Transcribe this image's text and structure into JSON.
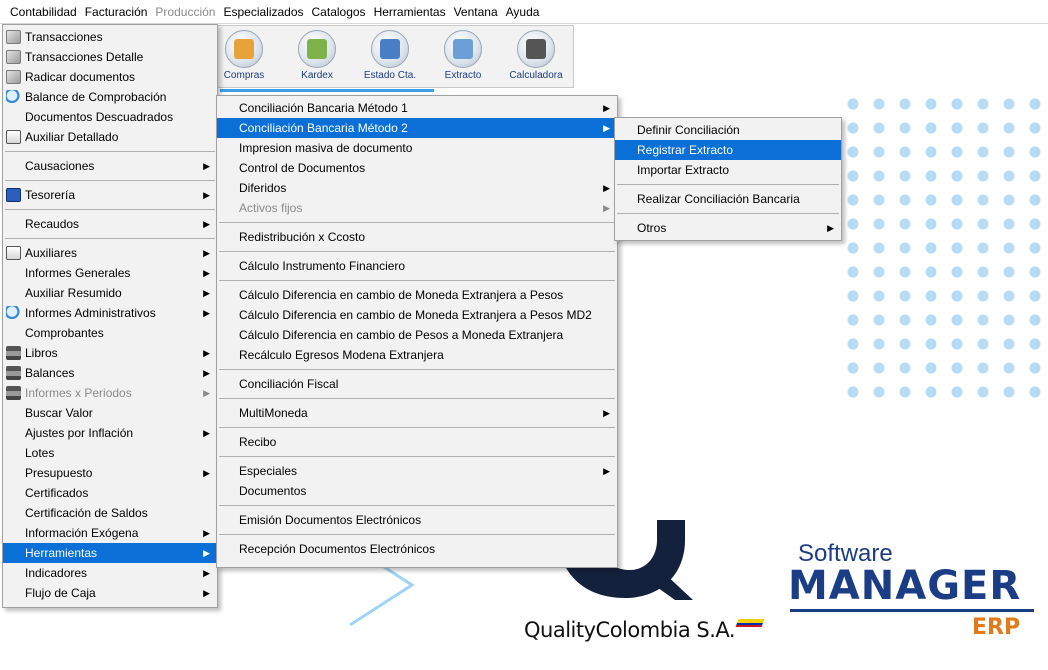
{
  "menubar": [
    {
      "label": "Contabilidad",
      "disabled": false
    },
    {
      "label": "Facturación",
      "disabled": false
    },
    {
      "label": "Producción",
      "disabled": true
    },
    {
      "label": "Especializados",
      "disabled": false
    },
    {
      "label": "Catalogos",
      "disabled": false
    },
    {
      "label": "Herramientas",
      "disabled": false
    },
    {
      "label": "Ventana",
      "disabled": false
    },
    {
      "label": "Ayuda",
      "disabled": false
    }
  ],
  "toolbar": [
    {
      "label": "Compras",
      "icon": "truck-icon",
      "color": "#e8a23a"
    },
    {
      "label": "Kardex",
      "icon": "kardex-icon",
      "color": "#7fb24a"
    },
    {
      "label": "Estado Cta.",
      "icon": "statement-icon",
      "color": "#4a7fc8"
    },
    {
      "label": "Extracto",
      "icon": "extract-icon",
      "color": "#6a9fd8"
    },
    {
      "label": "Calculadora",
      "icon": "calculator-icon",
      "color": "#555555"
    }
  ],
  "menu1": {
    "items": [
      {
        "label": "Transacciones",
        "icon": "grey"
      },
      {
        "label": "Transacciones Detalle",
        "icon": "grey"
      },
      {
        "label": "Radicar documentos",
        "icon": "grey"
      },
      {
        "label": "Balance de Comprobación",
        "icon": "mag"
      },
      {
        "label": "Documentos Descuadrados"
      },
      {
        "label": "Auxiliar Detallado",
        "icon": "note"
      },
      {
        "sep": true
      },
      {
        "label": "Causaciones",
        "sub": true
      },
      {
        "sep": true
      },
      {
        "label": "Tesorería",
        "icon": "tes",
        "sub": true
      },
      {
        "sep": true
      },
      {
        "label": "Recaudos",
        "sub": true
      },
      {
        "sep": true
      },
      {
        "label": "Auxiliares",
        "icon": "note",
        "sub": true
      },
      {
        "label": "Informes Generales",
        "sub": true
      },
      {
        "label": "Auxiliar Resumido",
        "sub": true
      },
      {
        "label": "Informes Administrativos",
        "icon": "mag",
        "sub": true
      },
      {
        "label": "Comprobantes"
      },
      {
        "label": "Libros",
        "icon": "print",
        "sub": true
      },
      {
        "label": "Balances",
        "icon": "print",
        "sub": true
      },
      {
        "label": "Informes x Periodos",
        "icon": "print",
        "sub": true,
        "disabled": true
      },
      {
        "label": "Buscar Valor"
      },
      {
        "label": "Ajustes por Inflación",
        "sub": true
      },
      {
        "label": "Lotes"
      },
      {
        "label": "Presupuesto",
        "sub": true
      },
      {
        "label": "Certificados"
      },
      {
        "label": "Certificación de Saldos"
      },
      {
        "label": "Información Exógena",
        "sub": true
      },
      {
        "label": "Herramientas",
        "sub": true,
        "highlight": true
      },
      {
        "label": "Indicadores",
        "sub": true
      },
      {
        "label": "Flujo de Caja",
        "sub": true
      }
    ]
  },
  "menu2": {
    "items": [
      {
        "label": "Conciliación Bancaria  Método 1",
        "sub": true
      },
      {
        "label": "Conciliación Bancaria Método 2",
        "sub": true,
        "highlight": true
      },
      {
        "label": "Impresion masiva de documento"
      },
      {
        "label": "Control de Documentos"
      },
      {
        "label": "Diferidos",
        "sub": true
      },
      {
        "label": "Activos fijos",
        "sub": true,
        "disabled": true
      },
      {
        "sep": true
      },
      {
        "label": "Redistribución x Ccosto"
      },
      {
        "sep": true
      },
      {
        "label": "Cálculo Instrumento Financiero"
      },
      {
        "sep": true
      },
      {
        "label": "Cálculo Diferencia en cambio de Moneda Extranjera a Pesos"
      },
      {
        "label": "Cálculo Diferencia en cambio de Moneda Extranjera a Pesos MD2"
      },
      {
        "label": "Cálculo Diferencia en cambio de Pesos a Moneda Extranjera"
      },
      {
        "label": "Recálculo Egresos Modena Extranjera"
      },
      {
        "sep": true
      },
      {
        "label": "Conciliación Fiscal"
      },
      {
        "sep": true
      },
      {
        "label": "MultiMoneda",
        "sub": true
      },
      {
        "sep": true
      },
      {
        "label": "Recibo"
      },
      {
        "sep": true
      },
      {
        "label": "Especiales",
        "sub": true
      },
      {
        "label": "Documentos"
      },
      {
        "sep": true
      },
      {
        "label": "Emisión Documentos Electrónicos"
      },
      {
        "sep": true
      },
      {
        "label": "Recepción Documentos Electrónicos"
      }
    ]
  },
  "menu3": {
    "items": [
      {
        "label": "Definir Conciliación"
      },
      {
        "label": "Registrar Extracto",
        "highlight": true
      },
      {
        "label": "Importar Extracto"
      },
      {
        "sep": true
      },
      {
        "label": "Realizar Conciliación Bancaria"
      },
      {
        "sep": true
      },
      {
        "label": "Otros",
        "sub": true
      }
    ]
  },
  "branding": {
    "quality": "QualityColombia S.A.",
    "software": "Software",
    "manager": "MANAGER",
    "erp": "ERP"
  },
  "colors": {
    "highlight": "#0a6fd6",
    "brand_blue": "#1a3d85",
    "brand_orange": "#e07a1a"
  }
}
